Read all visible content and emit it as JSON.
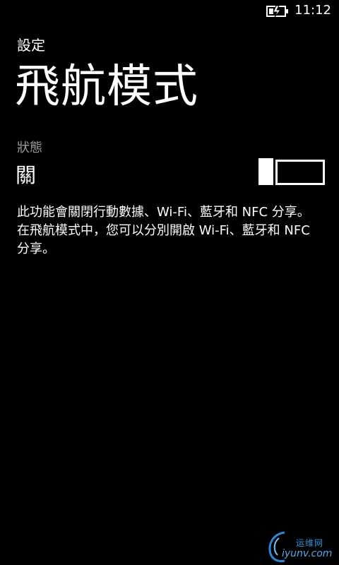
{
  "status_bar": {
    "time": "11:12",
    "battery_icon": "battery-charging-icon"
  },
  "header": {
    "app_title": "設定",
    "page_title": "飛航模式"
  },
  "setting": {
    "label": "狀態",
    "value": "關",
    "toggle_state": "off"
  },
  "description": "此功能會關閉行動數據、Wi-Fi、藍牙和 NFC 分享。在飛航模式中，您可以分別開啟 Wi-Fi、藍牙和 NFC 分享。",
  "watermark": {
    "text_top": "运维网",
    "text_bottom": "iyunv.com"
  },
  "colors": {
    "background": "#000000",
    "foreground": "#ffffff",
    "label": "#9a9a9a",
    "watermark": "#3a8fd8"
  }
}
